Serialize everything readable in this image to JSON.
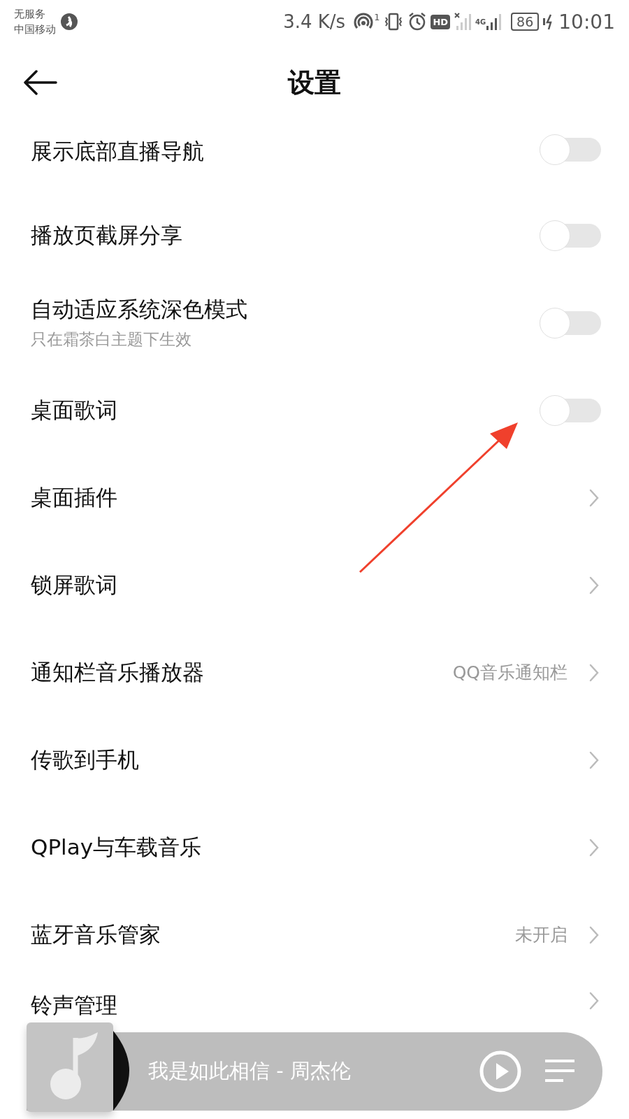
{
  "status_bar": {
    "carrier_lines": [
      "无服务",
      "中国移动"
    ],
    "speed": "3.4 K/s",
    "hotspot_count": "1",
    "hd": "HD",
    "network": "4G",
    "battery": "86",
    "time": "10:01"
  },
  "header": {
    "title": "设置"
  },
  "rows": [
    {
      "kind": "toggle",
      "label": "展示底部直播导航",
      "on": false
    },
    {
      "kind": "toggle",
      "label": "播放页截屏分享",
      "on": false
    },
    {
      "kind": "toggle",
      "label": "自动适应系统深色模式",
      "subtitle": "只在霜茶白主题下生效",
      "on": false
    },
    {
      "kind": "toggle",
      "label": "桌面歌词",
      "on": false
    },
    {
      "kind": "link",
      "label": "桌面插件"
    },
    {
      "kind": "link",
      "label": "锁屏歌词"
    },
    {
      "kind": "link",
      "label": "通知栏音乐播放器",
      "value": "QQ音乐通知栏"
    },
    {
      "kind": "link",
      "label": "传歌到手机"
    },
    {
      "kind": "link",
      "label": "QPlay与车载音乐"
    },
    {
      "kind": "link",
      "label": "蓝牙音乐管家",
      "value": "未开启"
    },
    {
      "kind": "link",
      "label": "铃声管理"
    }
  ],
  "player": {
    "track": "我是如此相信 - 周杰伦"
  }
}
